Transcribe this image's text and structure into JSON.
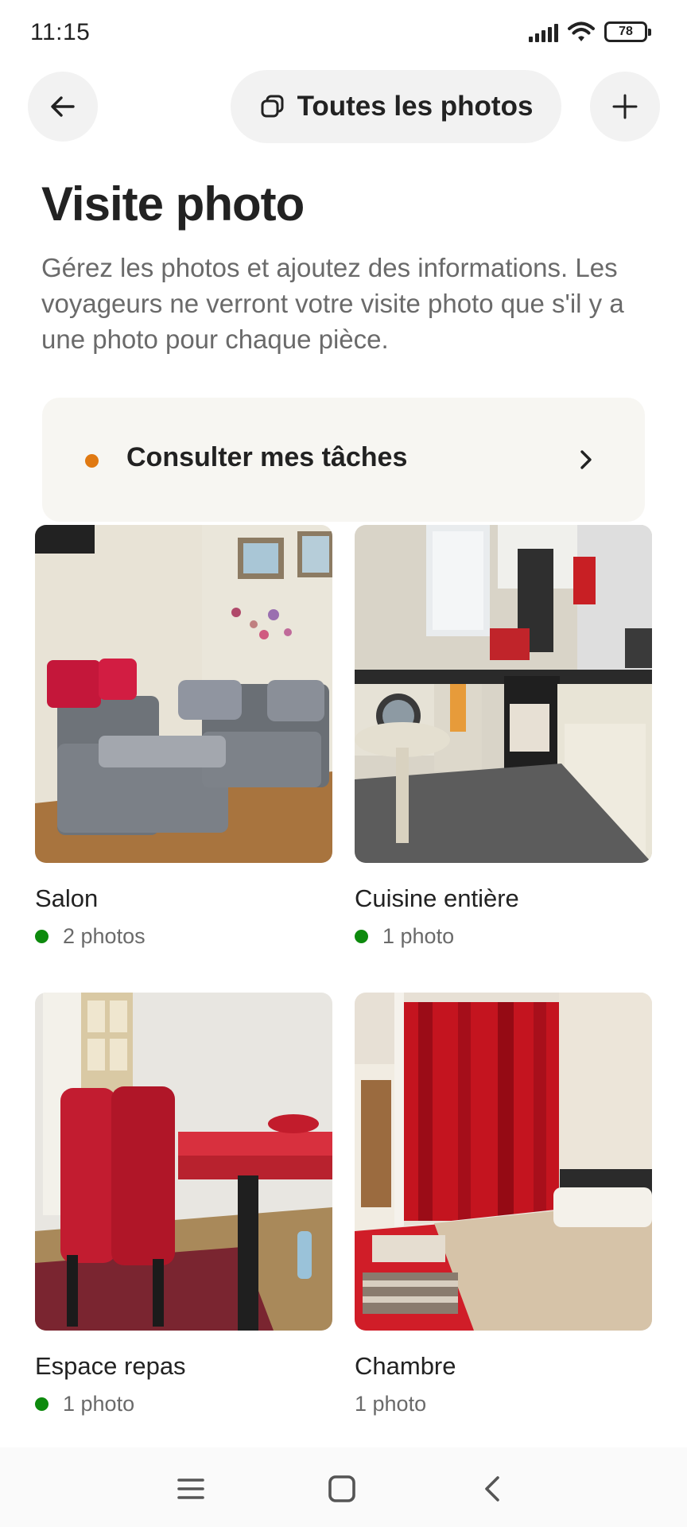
{
  "status_bar": {
    "time": "11:15",
    "battery": "78"
  },
  "header": {
    "all_photos_label": "Toutes les photos"
  },
  "page": {
    "title": "Visite photo",
    "description": "Gérez les photos et ajoutez des informations. Les voyageurs ne verront votre visite photo que s'il y a une photo pour chaque pièce."
  },
  "tasks": {
    "label": "Consulter mes tâches",
    "dot_color": "#e07912"
  },
  "rooms": [
    {
      "name": "Salon",
      "count": "2 photos",
      "complete": true
    },
    {
      "name": "Cuisine entière",
      "count": "1 photo",
      "complete": true
    },
    {
      "name": "Espace repas",
      "count": "1 photo",
      "complete": true
    },
    {
      "name": "Chambre",
      "count": "1 photo",
      "complete": false
    }
  ],
  "colors": {
    "status_complete": "#0d8a0d",
    "accent_orange": "#e07912",
    "pill_bg": "#f2f2f2"
  }
}
